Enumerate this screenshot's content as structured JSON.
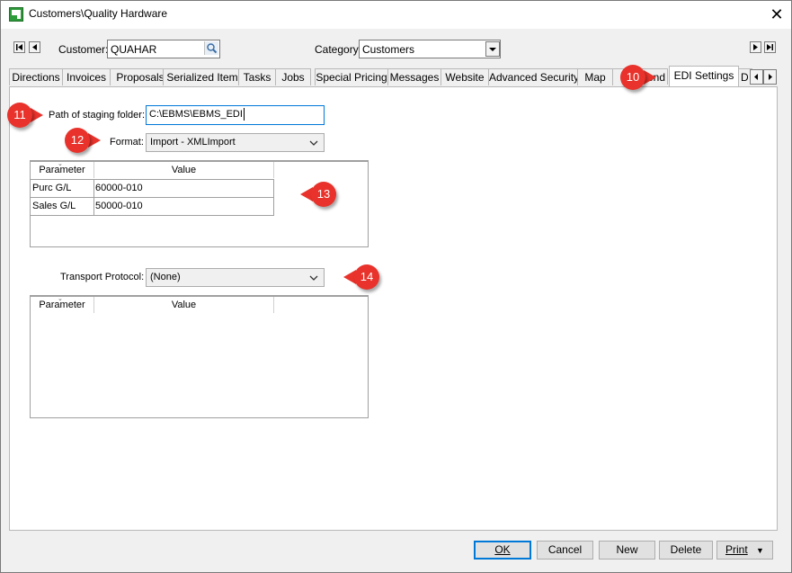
{
  "window": {
    "title": "Customers\\Quality Hardware"
  },
  "header": {
    "customer_label": "Customer:",
    "customer_value": "QUAHAR",
    "category_label": "Category:",
    "category_value": "Customers"
  },
  "tabs": [
    {
      "label": "Directions"
    },
    {
      "label": "Invoices"
    },
    {
      "label": "Proposals"
    },
    {
      "label": "Serialized Items"
    },
    {
      "label": "Tasks"
    },
    {
      "label": "Jobs"
    },
    {
      "label": "Special Pricing"
    },
    {
      "label": "Messages"
    },
    {
      "label": "Website"
    },
    {
      "label": "Advanced Security"
    },
    {
      "label": "Map"
    },
    {
      "label": "end"
    },
    {
      "label": "EDI Settings"
    },
    {
      "label": "D"
    }
  ],
  "edi": {
    "path_label": "Path of staging folder:",
    "path_value": "C:\\EBMS\\EBMS_EDI",
    "format_label": "Format:",
    "format_value": "Import - XMLImport",
    "grid1": {
      "columns": [
        "Parameter",
        "Value"
      ],
      "rows": [
        {
          "parameter": "Purc G/L",
          "value": "60000-010"
        },
        {
          "parameter": "Sales G/L",
          "value": "50000-010"
        }
      ]
    },
    "transport_label": "Transport Protocol:",
    "transport_value": "(None)",
    "grid2": {
      "columns": [
        "Parameter",
        "Value"
      ]
    }
  },
  "callouts": [
    "10",
    "11",
    "12",
    "13",
    "14"
  ],
  "buttons": {
    "ok": "OK",
    "cancel": "Cancel",
    "new": "New",
    "delete": "Delete",
    "print": "Print"
  },
  "colors": {
    "callout": "#e8322b",
    "focus": "#0078d7"
  }
}
